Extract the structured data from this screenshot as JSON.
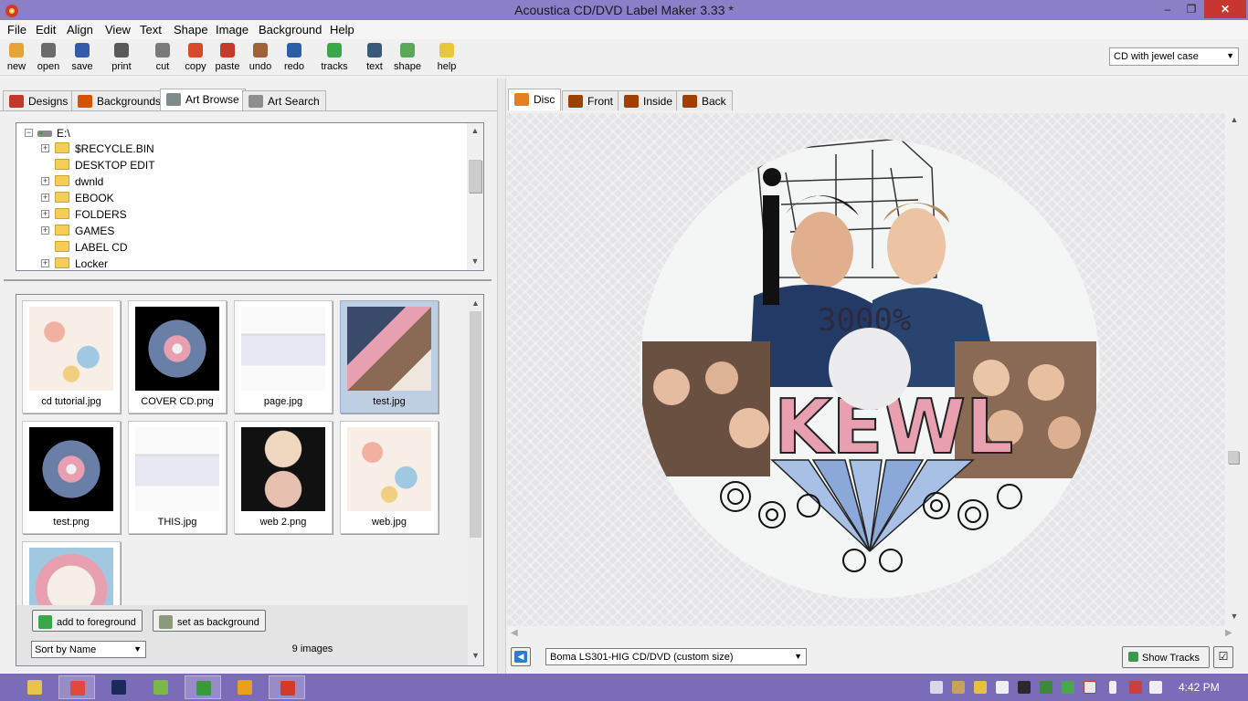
{
  "window": {
    "title": "Acoustica CD/DVD Label Maker 3.33 *",
    "controls": {
      "minimize": "–",
      "maximize": "❐",
      "close": "✕"
    }
  },
  "menu": [
    "File",
    "Edit",
    "Align",
    "View",
    "Text",
    "Shape",
    "Image",
    "Background",
    "Help"
  ],
  "toolbar": {
    "buttons": [
      {
        "label": "new",
        "icon": "new-icon",
        "color": "#e8a23a"
      },
      {
        "label": "open",
        "icon": "open-icon",
        "color": "#6b6b6b"
      },
      {
        "label": "save",
        "icon": "save-icon",
        "color": "#355aa8"
      },
      {
        "label": "print",
        "icon": "print-icon",
        "color": "#5a5a5a"
      },
      {
        "label": "cut",
        "icon": "cut-icon",
        "color": "#7a7a7a"
      },
      {
        "label": "copy",
        "icon": "copy-icon",
        "color": "#d94a2a"
      },
      {
        "label": "paste",
        "icon": "paste-icon",
        "color": "#c53a2a"
      },
      {
        "label": "undo",
        "icon": "undo-icon",
        "color": "#a0603a"
      },
      {
        "label": "redo",
        "icon": "redo-icon",
        "color": "#2a5ea8"
      },
      {
        "label": "tracks",
        "icon": "tracks-icon",
        "color": "#3aa84a"
      },
      {
        "label": "text",
        "icon": "text-icon",
        "color": "#3a5a7a"
      },
      {
        "label": "shape",
        "icon": "shape-icon",
        "color": "#5aa85a"
      },
      {
        "label": "help",
        "icon": "help-icon",
        "color": "#e8c83a"
      }
    ],
    "case_type": "CD with jewel case"
  },
  "left_tabs": [
    {
      "label": "Designs",
      "icon": "designs-icon",
      "color": "#c0392b"
    },
    {
      "label": "Backgrounds",
      "icon": "backgrounds-icon",
      "color": "#d35400"
    },
    {
      "label": "Art Browse",
      "icon": "art-browse-icon",
      "color": "#7f8c8d",
      "active": true
    },
    {
      "label": "Art Search",
      "icon": "art-search-icon",
      "color": "#8e8e8e"
    }
  ],
  "tree": {
    "root": "E:\\",
    "items": [
      {
        "label": "$RECYCLE.BIN",
        "expandable": true
      },
      {
        "label": "DESKTOP EDIT",
        "expandable": false
      },
      {
        "label": "dwnld",
        "expandable": true
      },
      {
        "label": "EBOOK",
        "expandable": true
      },
      {
        "label": "FOLDERS",
        "expandable": true
      },
      {
        "label": "GAMES",
        "expandable": true
      },
      {
        "label": "LABEL CD",
        "expandable": false
      },
      {
        "label": "Locker",
        "expandable": true
      }
    ]
  },
  "thumbnails": [
    {
      "name": "cd tutorial.jpg",
      "selected": false,
      "style": "flower"
    },
    {
      "name": "COVER CD.png",
      "selected": false,
      "style": "disc-dark"
    },
    {
      "name": "page.jpg",
      "selected": false,
      "style": "screen"
    },
    {
      "name": "test.jpg",
      "selected": true,
      "style": "collage"
    },
    {
      "name": "test.png",
      "selected": false,
      "style": "disc-dark"
    },
    {
      "name": "THIS.jpg",
      "selected": false,
      "style": "screen"
    },
    {
      "name": "web 2.png",
      "selected": false,
      "style": "two-discs"
    },
    {
      "name": "web.jpg",
      "selected": false,
      "style": "flower"
    },
    {
      "name": "",
      "selected": false,
      "style": "flower-disc"
    }
  ],
  "buttons": {
    "add_foreground": "add to foreground",
    "set_background": "set as background",
    "sort": "Sort by Name",
    "image_count": "9 images"
  },
  "right_tabs": [
    {
      "label": "Disc",
      "icon": "disc-icon",
      "color": "#e67e22",
      "active": true
    },
    {
      "label": "Front",
      "icon": "front-icon",
      "color": "#a04000"
    },
    {
      "label": "Inside",
      "icon": "inside-icon",
      "color": "#a04000"
    },
    {
      "label": "Back",
      "icon": "back-icon",
      "color": "#a04000"
    }
  ],
  "disc": {
    "text_top": "3000%",
    "text_big": "KEWL",
    "letter": "i",
    "accent_pink": "#e8a0b0",
    "accent_blue": "#8aa8d8"
  },
  "bottom": {
    "label_type": "Boma LS301-HIG CD/DVD (custom size)",
    "show_tracks": "Show Tracks"
  },
  "taskbar": {
    "apps": [
      {
        "icon": "file-explorer-icon",
        "color": "#e8c34a",
        "active": false
      },
      {
        "icon": "chrome-icon",
        "color": "#e04a3a",
        "active": true
      },
      {
        "icon": "photoshop-icon",
        "color": "#1a2a5a",
        "active": false
      },
      {
        "icon": "image-viewer-icon",
        "color": "#7ab84a",
        "active": false
      },
      {
        "icon": "clover-icon",
        "color": "#3a9a3a",
        "active": true
      },
      {
        "icon": "media-player-icon",
        "color": "#e8a020",
        "active": false
      },
      {
        "icon": "label-maker-icon",
        "color": "#d33a2a",
        "active": true
      }
    ],
    "clock": "4:42 PM"
  }
}
